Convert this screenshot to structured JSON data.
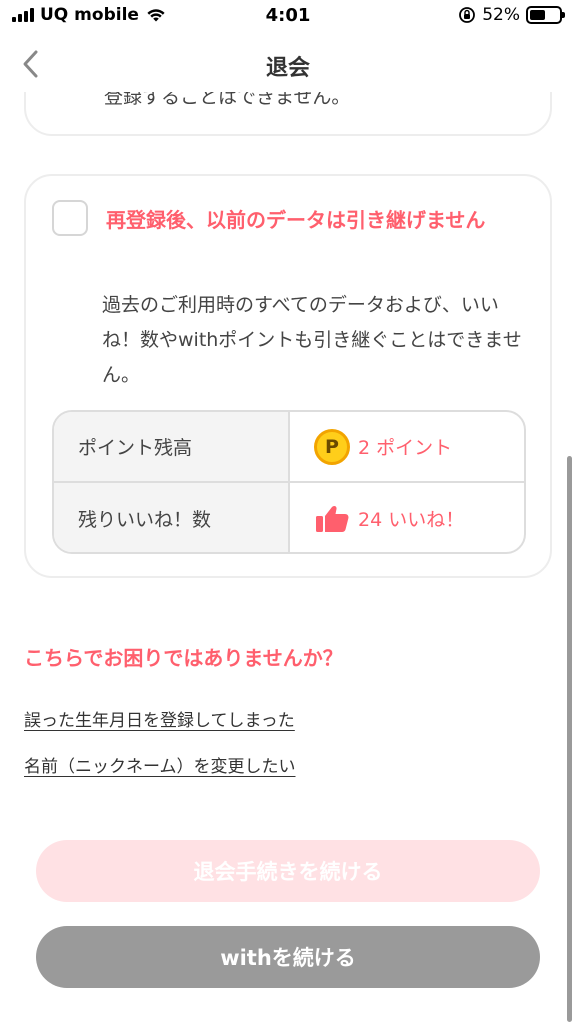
{
  "status_bar": {
    "carrier": "UQ mobile",
    "time": "4:01",
    "battery_percent": "52%",
    "battery_level": 0.52
  },
  "nav": {
    "title": "退会",
    "back_icon": "chevron-left-icon"
  },
  "top_card": {
    "partial_text": "登録することはできません。"
  },
  "data_card": {
    "heading": "再登録後、以前のデータは引き継げません",
    "description": "過去のご利用時のすべてのデータおよび、いいね！数やwithポイントも引き継ぐことはできません。",
    "checked": false,
    "rows": [
      {
        "label": "ポイント残高",
        "value": "2 ポイント",
        "icon": "coin-icon",
        "icon_text": "P"
      },
      {
        "label": "残りいいね！数",
        "value": "24 いいね！",
        "icon": "thumbs-up-icon"
      }
    ]
  },
  "help": {
    "title": "こちらでお困りではありませんか？",
    "links": [
      "誤った生年月日を登録してしまった",
      "名前（ニックネーム）を変更したい"
    ]
  },
  "buttons": {
    "leave_label": "退会手続きを続ける",
    "continue_label": "withを続ける"
  },
  "colors": {
    "accent": "#ff5f6d",
    "leave_button_bg": "#ffe1e4",
    "continue_button_bg": "#9a9a9a"
  }
}
